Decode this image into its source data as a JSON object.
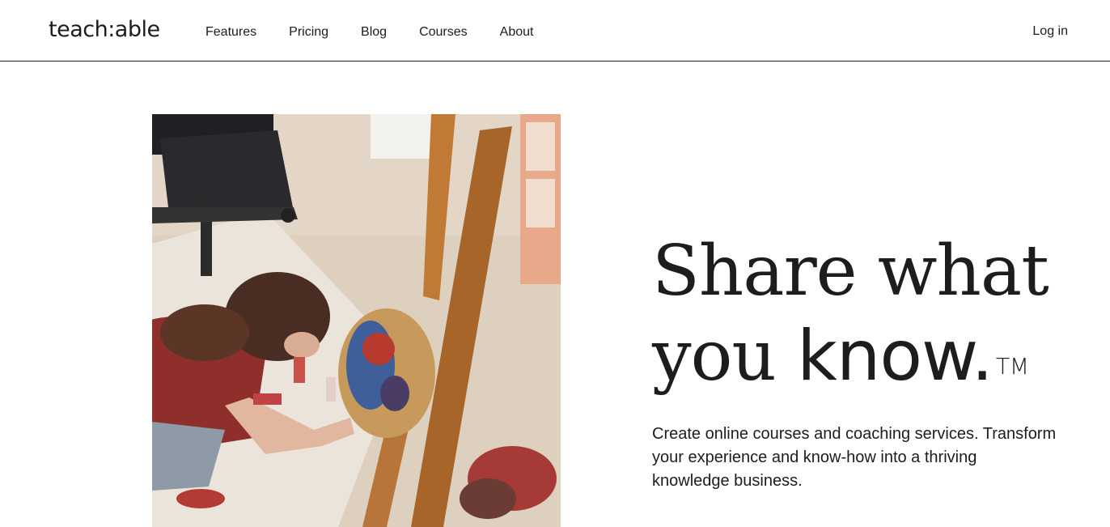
{
  "header": {
    "logo": "teach:able",
    "nav": [
      "Features",
      "Pricing",
      "Blog",
      "Courses",
      "About"
    ],
    "login": "Log in"
  },
  "hero": {
    "headline_line1": "Share what",
    "headline_line2_regular": "you ",
    "headline_line2_bold": "know.",
    "trademark": "TM",
    "subtext": "Create online courses and coaching services. Transform your experience and know-how into a thriving knowledge business.",
    "image": "artist-painting-photo"
  }
}
